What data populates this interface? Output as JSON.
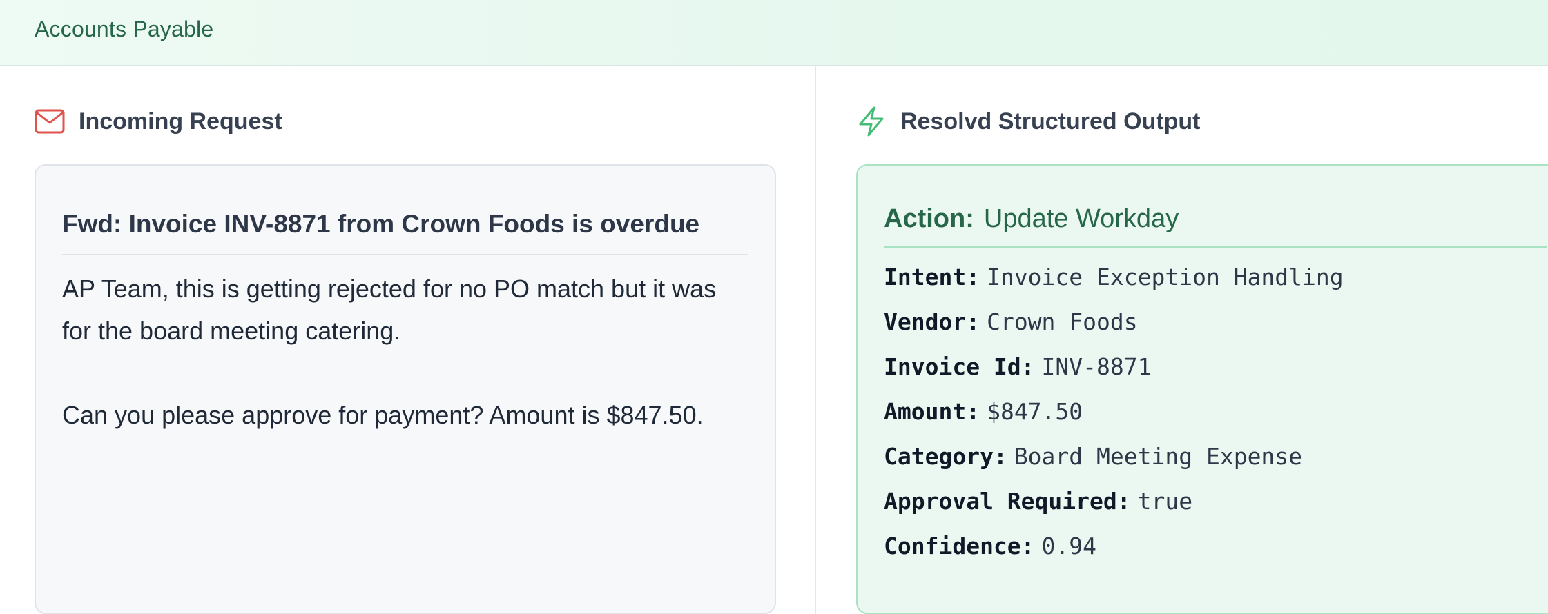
{
  "header": {
    "title": "Accounts Payable"
  },
  "left_panel": {
    "heading": "Incoming Request",
    "icon": "mail-icon",
    "subject": "Fwd: Invoice INV-8871 from Crown Foods is overdue",
    "body": "AP Team, this is getting rejected for no PO match but it was for the board meeting catering.\n\nCan you please approve for payment? Amount is $847.50."
  },
  "right_panel": {
    "heading": "Resolvd Structured Output",
    "icon": "lightning-bolt-icon",
    "action_label": "Action:",
    "action_value": "Update Workday",
    "fields": [
      {
        "key": "Intent:",
        "value": "Invoice Exception Handling"
      },
      {
        "key": "Vendor:",
        "value": "Crown Foods"
      },
      {
        "key": "Invoice Id:",
        "value": "INV-8871"
      },
      {
        "key": "Amount:",
        "value": "$847.50"
      },
      {
        "key": "Category:",
        "value": "Board Meeting Expense"
      },
      {
        "key": "Approval Required:",
        "value": "true"
      },
      {
        "key": "Confidence:",
        "value": "0.94"
      }
    ]
  },
  "colors": {
    "brand_green": "#276749",
    "mail_icon_red": "#e0524c",
    "bolt_icon_green": "#48bb78",
    "output_card_bg": "#ebf8f1",
    "output_card_border": "#a9e3c3"
  }
}
